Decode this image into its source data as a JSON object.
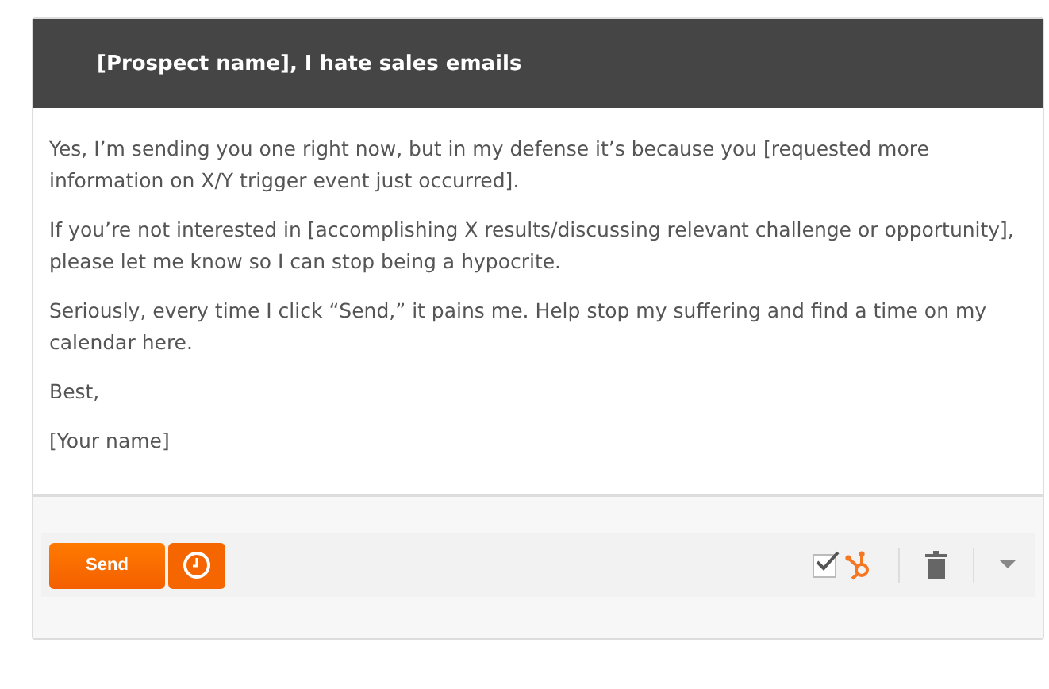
{
  "email": {
    "subject": "[Prospect name], I hate sales emails",
    "paragraphs": [
      "Yes, I’m sending you one right now, but in my defense it’s because you [requested more information on X/Y trigger event just occurred].",
      "If you’re not interested in [accomplishing X results/discussing relevant challenge or opportunity], please let me know so I can stop being a hypocrite.",
      "Seriously, every time I click “Send,” it pains me. Help stop my suffering and find a time on my calendar here.",
      "Best,",
      "[Your name]"
    ]
  },
  "toolbar": {
    "send_label": "Send",
    "log_checked": true
  }
}
